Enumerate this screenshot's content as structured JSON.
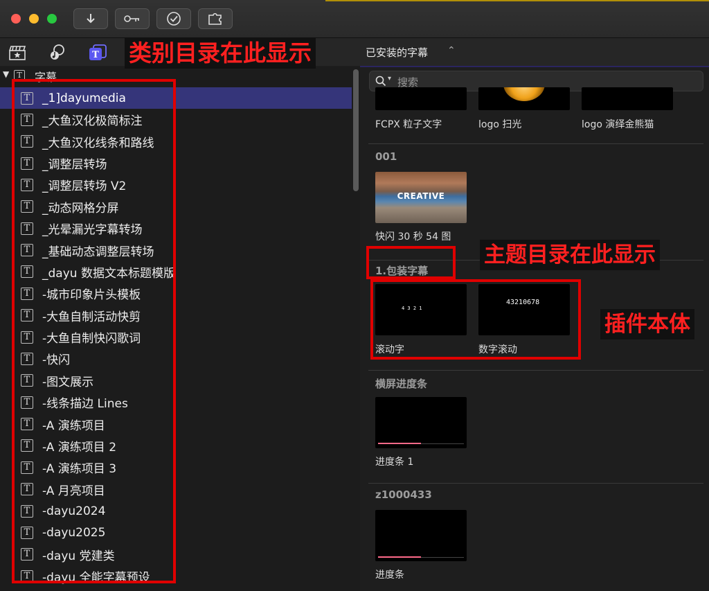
{
  "library_label": "已安装的字幕",
  "search": {
    "placeholder": "搜索"
  },
  "sidebar": {
    "root_label": "字幕",
    "items": [
      "_1]dayumedia",
      "_大鱼汉化极简标注",
      "_大鱼汉化线条和路线",
      "_调整层转场",
      "_调整层转场 V2",
      "_动态网格分屏",
      "_光晕漏光字幕转场",
      "_基础动态调整层转场",
      "_dayu 数据文本标题模版",
      "-城市印象片头模板",
      "-大鱼自制活动快剪",
      "-大鱼自制快闪歌词",
      "-快闪",
      "-图文展示",
      "-线条描边 Lines",
      "-A 演练项目",
      "-A 演练项目 2",
      "-A 演练项目 3",
      "-A 月亮项目",
      "-dayu2024",
      "-dayu2025",
      "-dayu 党建类",
      "-dayu 全能字幕预设"
    ]
  },
  "browser": {
    "top_items": [
      "FCPX 粒子文字",
      "logo 扫光",
      "logo 演绎金熊猫"
    ],
    "groups": [
      {
        "title": "001",
        "items": [
          {
            "label": "快闪 30 秒 54 图",
            "thumb_text": "CREATIVE"
          }
        ]
      },
      {
        "title": "1.包装字幕",
        "items": [
          {
            "label": "滚动字",
            "thumb_text": "4 3 2 1"
          },
          {
            "label": "数字滚动",
            "thumb_text": "43210678"
          }
        ]
      },
      {
        "title": "横屏进度条",
        "items": [
          {
            "label": "进度条 1"
          }
        ]
      },
      {
        "title": "z1000433",
        "items": [
          {
            "label": "进度条"
          }
        ]
      }
    ]
  },
  "annotations": {
    "category_note": "类别目录在此显示",
    "theme_note": "主题目录在此显示",
    "plugin_note": "插件本体"
  },
  "colors": {
    "selection": "#35357a",
    "annotation_red": "#e00000"
  }
}
